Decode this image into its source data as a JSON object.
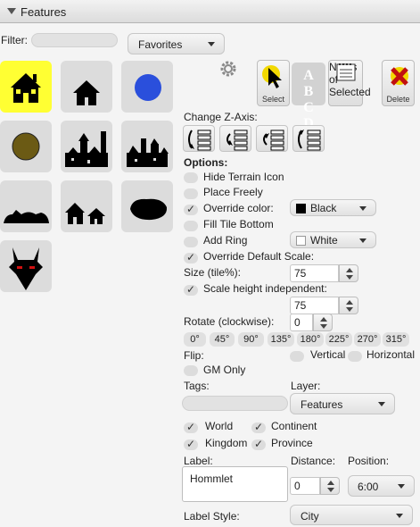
{
  "header": {
    "title": "Features"
  },
  "filter": {
    "label": "Filter:",
    "value": "",
    "dropdown": "Favorites"
  },
  "icons": [
    "house-icon",
    "small-house-icon",
    "blue-circle-icon",
    "olive-circle-icon",
    "town-icon",
    "ruined-town-icon",
    "hill-village-icon",
    "cottages-icon",
    "black-blob-icon",
    "horned-demon-icon"
  ],
  "toolbar": {
    "select_label": "Select",
    "abcd_text": "A B C D",
    "notes_label": "Notes of Selected",
    "delete_label": "Delete"
  },
  "zaxis": {
    "label": "Change Z-Axis:"
  },
  "options": {
    "label": "Options:",
    "hide_terrain": "Hide Terrain Icon",
    "place_freely": "Place Freely",
    "override_color": "Override color:",
    "color_value": "Black",
    "fill_tile_bottom": "Fill Tile Bottom",
    "add_ring": "Add Ring",
    "ring_color_value": "White",
    "override_scale": "Override Default Scale:",
    "size_label": "Size (tile%):",
    "size_value": "75",
    "scale_height": "Scale height independent:",
    "height_value": "75",
    "rotate_label": "Rotate (clockwise):",
    "rotate_value": "0",
    "rotations": [
      "0°",
      "45°",
      "90°",
      "135°",
      "180°",
      "225°",
      "270°",
      "315°"
    ],
    "flip_label": "Flip:",
    "vertical": "Vertical",
    "horizontal": "Horizontal",
    "gm_only": "GM Only"
  },
  "tags": {
    "label": "Tags:",
    "value": ""
  },
  "layer": {
    "label": "Layer:",
    "value": "Features"
  },
  "checks": {
    "world": "World",
    "continent": "Continent",
    "kingdom": "Kingdom",
    "province": "Province"
  },
  "label_section": {
    "label": "Label:",
    "value": "Hommlet",
    "distance_label": "Distance:",
    "distance_value": "0",
    "position_label": "Position:",
    "position_value": "6:00",
    "style_label": "Label Style:",
    "style_value": "City"
  },
  "colors": {
    "selected_tile": "#ffff33",
    "blue_dot": "#2a4fdc",
    "olive_dot": "#6b5a14",
    "delete_x": "#c01010",
    "select_circle": "#f2d800"
  }
}
